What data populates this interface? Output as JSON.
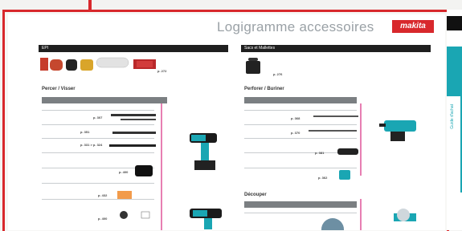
{
  "header": {
    "title": "Logigramme accessoires",
    "brand": "makita"
  },
  "sections": {
    "epi": {
      "label": "EPI"
    },
    "sacs": {
      "label": "Sacs et Mallettes"
    },
    "percer": {
      "label": "Percer / Visser"
    },
    "perforer": {
      "label": "Perforer / Buriner"
    },
    "decouper": {
      "label": "Découper"
    }
  },
  "codes": {
    "epi_code": "p. 272",
    "sacs_code": "p. 276",
    "percer": [
      "p. 307",
      "p. 351",
      "p. 331 > p. 324",
      "p. 400",
      "p. 432",
      "p. 400"
    ],
    "perforer": [
      "p. 368",
      "p. 370",
      "p. 381",
      "p. 362"
    ]
  },
  "rail": {
    "tab_text": "Guide d'achat"
  },
  "colors": {
    "brand": "#d8282c",
    "teal": "#1aa6b3",
    "pink": "#e77fb2"
  }
}
